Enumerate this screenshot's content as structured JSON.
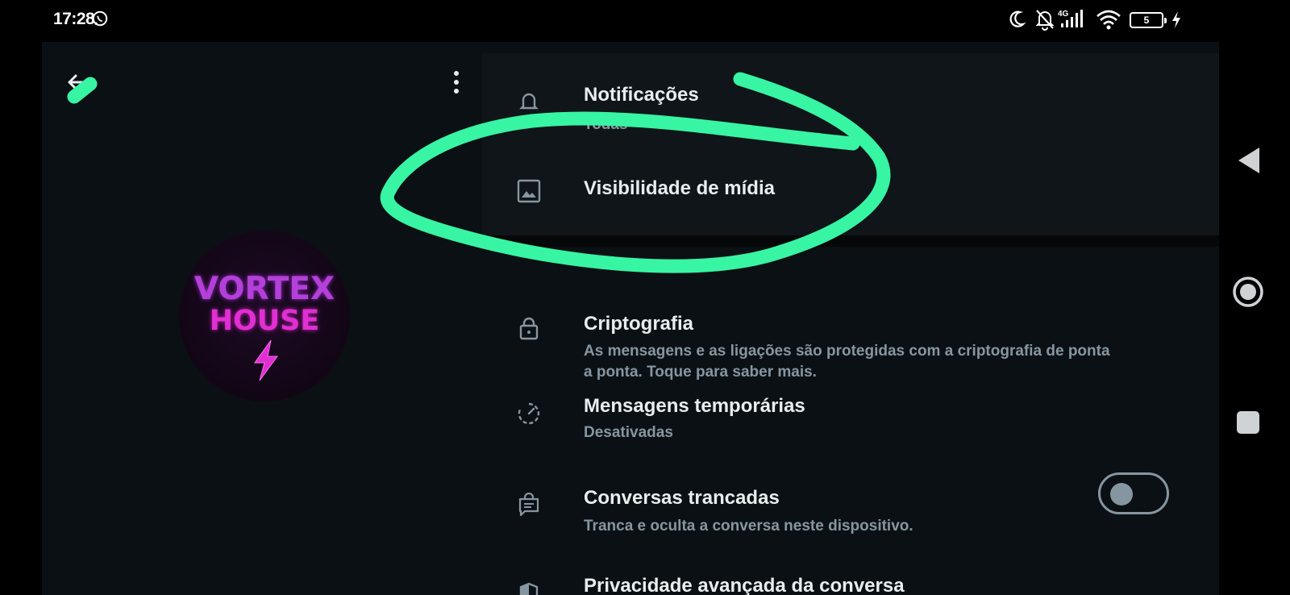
{
  "status_bar": {
    "time": "17:28",
    "battery": "5",
    "network": "4G"
  },
  "chat_info": {
    "avatar_line1": "VORTEX",
    "avatar_line2": "HOUSE"
  },
  "settings": {
    "notifications": {
      "title": "Notificações",
      "subtitle": "Todas"
    },
    "media_visibility": {
      "title": "Visibilidade de mídia"
    },
    "encryption": {
      "title": "Criptografia",
      "subtitle_line1": "As mensagens e as ligações são protegidas com a criptografia de ponta",
      "subtitle_line2": "a ponta. Toque para saber mais."
    },
    "disappearing": {
      "title": "Mensagens temporárias",
      "subtitle": "Desativadas"
    },
    "locked_chats": {
      "title": "Conversas trancadas",
      "subtitle": "Tranca e oculta a conversa neste dispositivo.",
      "enabled": false
    },
    "advanced_privacy": {
      "title": "Privacidade avançada da conversa"
    }
  },
  "colors": {
    "background": "#0b1014",
    "card": "#0f1519",
    "text_primary": "#e9edef",
    "text_secondary": "#8696a0",
    "annotation": "#37f5a3"
  },
  "icons": [
    "whatsapp-icon",
    "moon-icon",
    "bell-off-icon",
    "signal-icon",
    "wifi-icon",
    "battery-icon",
    "bolt-icon",
    "back-arrow-icon",
    "more-vert-icon",
    "bell-icon",
    "image-icon",
    "lock-icon",
    "timer-icon",
    "chat-lock-icon",
    "shield-icon",
    "nav-back-icon",
    "nav-home-icon",
    "nav-recents-icon"
  ]
}
